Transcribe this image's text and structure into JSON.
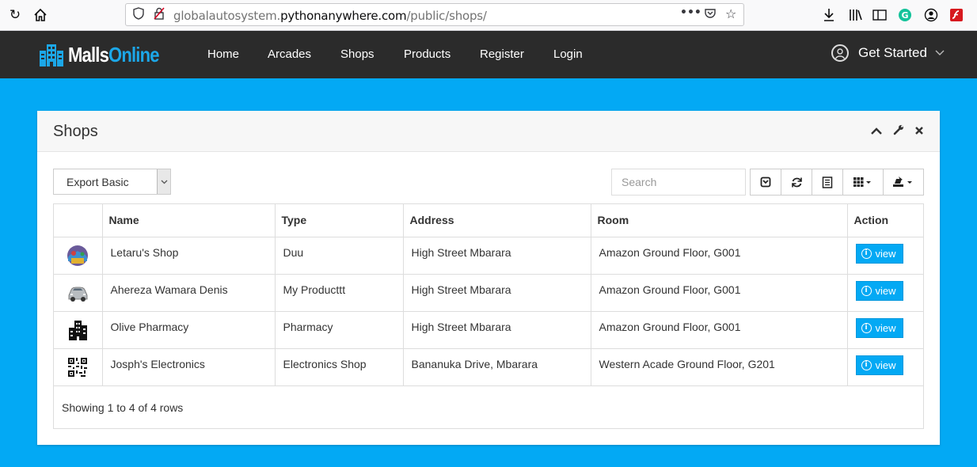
{
  "browser": {
    "url_prefix": "globalautosystem.",
    "url_domain": "pythonanywhere.com",
    "url_path": "/public/shops/"
  },
  "brand": {
    "part1": "Malls",
    "part2": "Online"
  },
  "nav": {
    "items": [
      "Home",
      "Arcades",
      "Shops",
      "Products",
      "Register",
      "Login"
    ],
    "get_started": "Get Started"
  },
  "panel": {
    "title": "Shops"
  },
  "toolbar": {
    "export_label": "Export Basic",
    "search_placeholder": "Search"
  },
  "table": {
    "headers": [
      "",
      "Name",
      "Type",
      "Address",
      "Room",
      "Action"
    ],
    "rows": [
      {
        "icon": "shop-thumbnail-icon",
        "name": "Letaru's Shop",
        "type": "Duu",
        "address": "High Street Mbarara",
        "room": "Amazon Ground Floor, G001",
        "action": "view"
      },
      {
        "icon": "car-thumbnail-icon",
        "name": "Ahereza Wamara Denis",
        "type": "My Producttt",
        "address": "High Street Mbarara",
        "room": "Amazon Ground Floor, G001",
        "action": "view"
      },
      {
        "icon": "building-thumbnail-icon",
        "name": "Olive Pharmacy",
        "type": "Pharmacy",
        "address": "High Street Mbarara",
        "room": "Amazon Ground Floor, G001",
        "action": "view"
      },
      {
        "icon": "qr-code-thumbnail-icon",
        "name": "Josph's Electronics",
        "type": "Electronics Shop",
        "address": "Bananuka Drive, Mbarara",
        "room": "Western Acade Ground Floor, G201",
        "action": "view"
      }
    ],
    "footer": "Showing 1 to 4 of 4 rows"
  },
  "colors": {
    "accent": "#03a9f4",
    "navbar": "#2b2b2b",
    "brand_blue": "#1ca7e8"
  }
}
